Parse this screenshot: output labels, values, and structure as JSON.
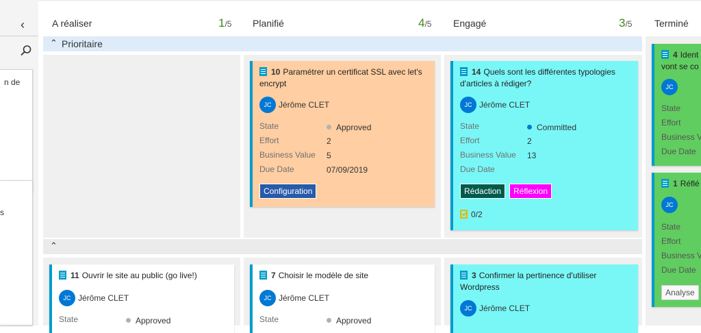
{
  "left_panel": {
    "collapse_icon": "chevron-left-icon",
    "search_icon": "search-icon",
    "card1_text": "n de",
    "card2_text": "s"
  },
  "columns": [
    {
      "name": "A réaliser",
      "count": "1",
      "limit": "/5"
    },
    {
      "name": "Planifié",
      "count": "4",
      "limit": "/5"
    },
    {
      "name": "Engagé",
      "count": "3",
      "limit": "/5"
    },
    {
      "name": "Terminé"
    }
  ],
  "lanes": {
    "priority": {
      "label": "Prioritaire"
    },
    "default": {
      "label": ""
    }
  },
  "cards": {
    "c10": {
      "id": "10",
      "title": "Paramétrer un certificat SSL avec let's encrypt",
      "user_initials": "JC",
      "user": "Jérôme CLET",
      "state_label": "State",
      "state": "Approved",
      "effort_label": "Effort",
      "effort": "2",
      "bv_label": "Business Value",
      "bv": "5",
      "due_label": "Due Date",
      "due": "07/09/2019",
      "tag": "Configuration"
    },
    "c14": {
      "id": "14",
      "title": "Quels sont les différentes typologies d'articles à rédiger?",
      "user_initials": "JC",
      "user": "Jérôme CLET",
      "state_label": "State",
      "state": "Committed",
      "effort_label": "Effort",
      "effort": "2",
      "bv_label": "Business Value",
      "bv": "13",
      "due_label": "Due Date",
      "tag1": "Rédaction",
      "tag2": "Réflexion",
      "checklist": "0/2"
    },
    "c4": {
      "id": "4",
      "title": "Ident vont se co",
      "user_initials": "JC",
      "state_label": "State",
      "effort_label": "Effort",
      "bv_label": "Business Va",
      "due_label": "Due Date"
    },
    "c1": {
      "id": "1",
      "title": "Réflé",
      "user_initials": "JC",
      "state_label": "State",
      "effort_label": "Effort",
      "bv_label": "Business Va",
      "due_label": "Due Date",
      "tag": "Analyse"
    },
    "c11": {
      "id": "11",
      "title": "Ouvrir le site au public (go live!)",
      "user_initials": "JC",
      "user": "Jérôme CLET",
      "state_label": "State",
      "state": "Approved"
    },
    "c7": {
      "id": "7",
      "title": "Choisir le modèle de site",
      "user_initials": "JC",
      "user": "Jérôme CLET",
      "state_label": "State",
      "state": "Approved"
    },
    "c3": {
      "id": "3",
      "title": "Confirmer la pertinence d'utiliser Wordpress",
      "user_initials": "JC",
      "user": "Jérôme CLET"
    }
  },
  "colors": {
    "approved_dot": "#b2b2b2",
    "committed_dot": "#007acc",
    "configuration_tag": "#275aa9",
    "redaction_tag": "#005a4c",
    "reflexion_tag": "#ff00ff",
    "count_green": "#3a8a1a"
  }
}
